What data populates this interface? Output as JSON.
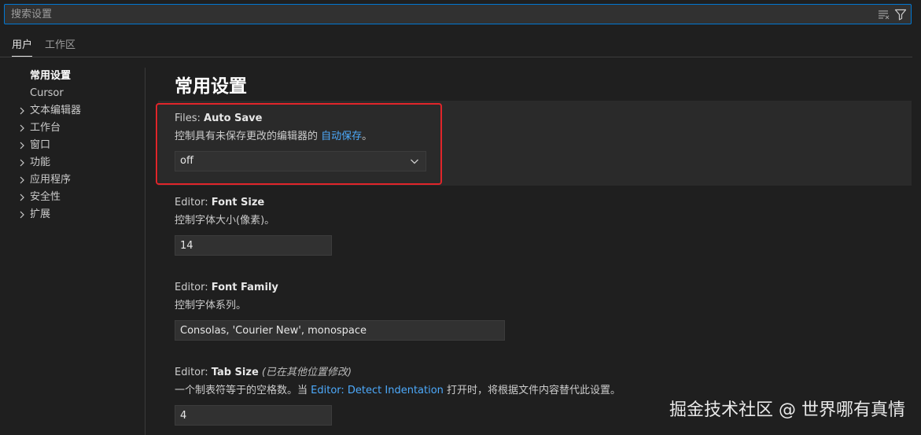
{
  "search": {
    "placeholder": "搜索设置"
  },
  "tabs": [
    {
      "label": "用户"
    },
    {
      "label": "工作区"
    }
  ],
  "toc": [
    {
      "label": "常用设置"
    },
    {
      "label": "Cursor"
    },
    {
      "label": "文本编辑器"
    },
    {
      "label": "工作台"
    },
    {
      "label": "窗口"
    },
    {
      "label": "功能"
    },
    {
      "label": "应用程序"
    },
    {
      "label": "安全性"
    },
    {
      "label": "扩展"
    }
  ],
  "section_title": "常用设置",
  "settings": [
    {
      "category": "Files: ",
      "name": "Auto Save",
      "desc": "控制具有未保存更改的编辑器的 ",
      "desc_link": "自动保存",
      "desc_after": "。",
      "value": "off"
    },
    {
      "category": "Editor: ",
      "name": "Font Size",
      "desc": "控制字体大小(像素)。",
      "value": "14"
    },
    {
      "category": "Editor: ",
      "name": "Font Family",
      "desc": "控制字体系列。",
      "value": "Consolas, 'Courier New', monospace"
    },
    {
      "category": "Editor: ",
      "name": "Tab Size",
      "modified": "(已在其他位置修改)",
      "desc": "一个制表符等于的空格数。当 ",
      "desc_link": "Editor: Detect Indentation",
      "desc_after": " 打开时，将根据文件内容替代此设置。",
      "value": "4"
    }
  ],
  "watermark": "掘金技术社区 @ 世界哪有真情",
  "colors": {
    "accent": "#0078d4",
    "link": "#4daafc",
    "highlight": "#e0252a"
  }
}
